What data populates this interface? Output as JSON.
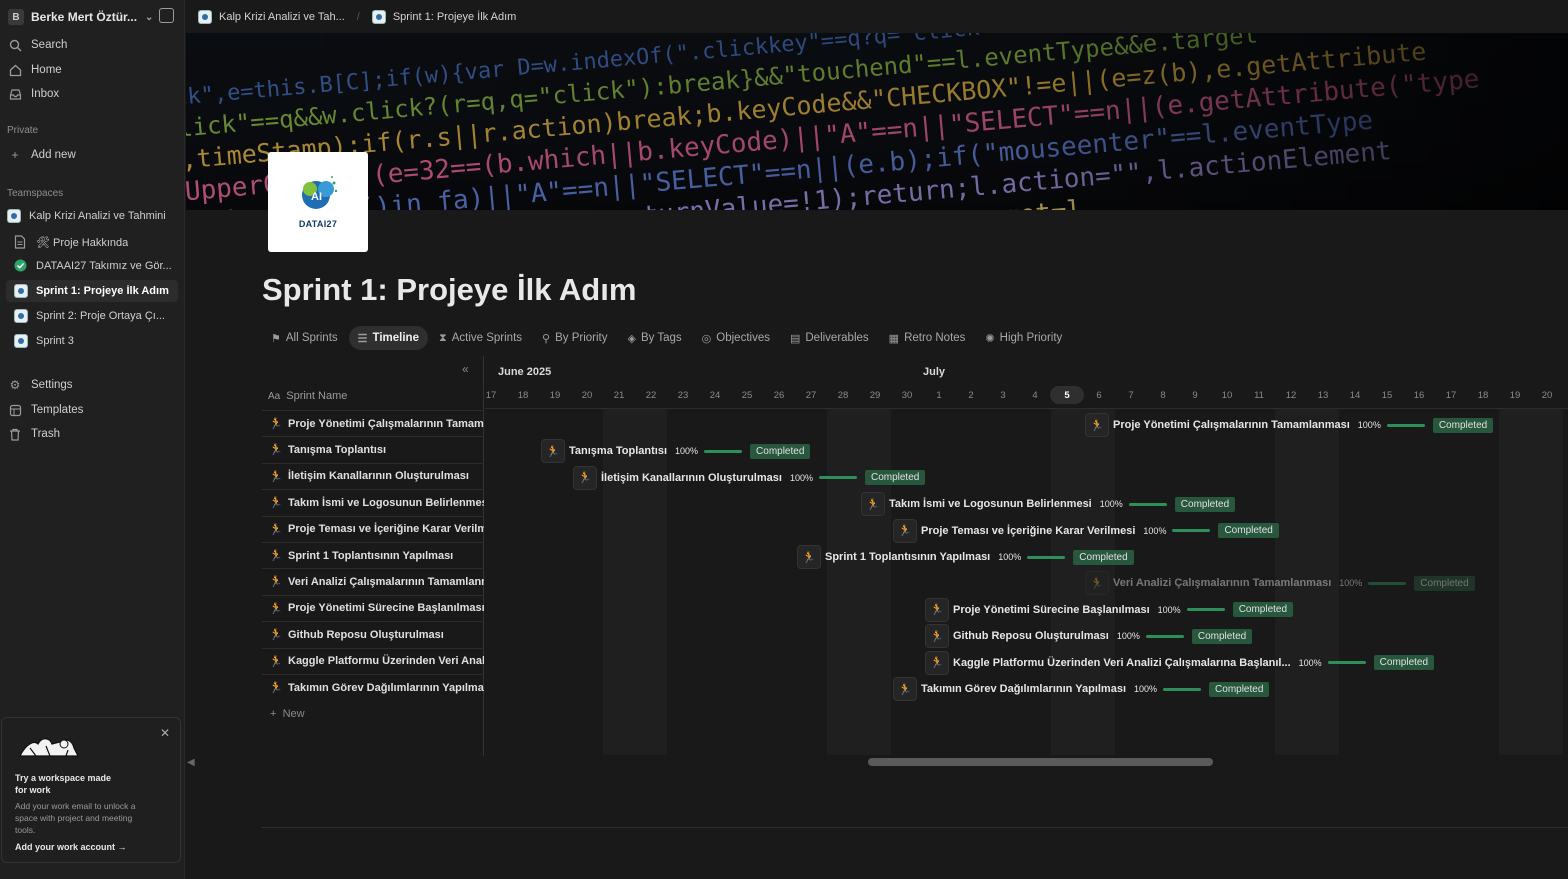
{
  "workspace": {
    "avatar": "B",
    "name": "Berke Mert Öztür..."
  },
  "sidebar": {
    "nav": [
      {
        "label": "Search",
        "icon": "search-icon"
      },
      {
        "label": "Home",
        "icon": "home-icon"
      },
      {
        "label": "Inbox",
        "icon": "inbox-icon"
      }
    ],
    "private_label": "Private",
    "add_new": "Add new",
    "teamspaces_label": "Teamspaces",
    "teamspace": "Kalp Krizi Analizi ve Tahmini",
    "pages": [
      {
        "label": "🛠 Proje Hakkında",
        "icon": "document-icon"
      },
      {
        "label": "DATAAI27 Takımız ve Gör...",
        "icon": "check-circle-icon"
      },
      {
        "label": "Sprint 1: Projeye İlk Adım",
        "icon": "page-logo-icon",
        "active": true
      },
      {
        "label": "Sprint 2: Proje Ortaya Çı...",
        "icon": "page-logo-icon"
      },
      {
        "label": "Sprint 3",
        "icon": "page-logo-icon"
      }
    ],
    "bottom": [
      {
        "label": "Settings",
        "icon": "gear-icon"
      },
      {
        "label": "Templates",
        "icon": "templates-icon"
      },
      {
        "label": "Trash",
        "icon": "trash-icon"
      }
    ],
    "promo": {
      "title": "Try a workspace made for work",
      "text": "Add your work email to unlock a space with project and meeting tools.",
      "cta": "Add your work account"
    }
  },
  "tabs": [
    {
      "label": "Kalp Krizi Analizi ve Tah..."
    },
    {
      "label": "Sprint 1: Projeye İlk Adım"
    }
  ],
  "logo_text": "DATAI27",
  "page_title": "Sprint 1: Projeye İlk Adım",
  "views": [
    {
      "label": "All Sprints",
      "icon": "flag-icon"
    },
    {
      "label": "Timeline",
      "icon": "timeline-icon",
      "active": true
    },
    {
      "label": "Active Sprints",
      "icon": "hourglass-icon"
    },
    {
      "label": "By Priority",
      "icon": "pin-icon"
    },
    {
      "label": "By Tags",
      "icon": "tag-icon"
    },
    {
      "label": "Objectives",
      "icon": "target-icon"
    },
    {
      "label": "Deliverables",
      "icon": "box-icon"
    },
    {
      "label": "Retro Notes",
      "icon": "notes-icon"
    },
    {
      "label": "High Priority",
      "icon": "fire-icon"
    }
  ],
  "table": {
    "column": "Sprint Name",
    "new_label": "New"
  },
  "timeline": {
    "months": [
      {
        "label": "June 2025"
      },
      {
        "label": "July"
      }
    ],
    "days": [
      "17",
      "18",
      "19",
      "20",
      "21",
      "22",
      "23",
      "24",
      "25",
      "26",
      "27",
      "28",
      "29",
      "30",
      "1",
      "2",
      "3",
      "4",
      "5",
      "6",
      "7",
      "8",
      "9",
      "10",
      "11",
      "12",
      "13",
      "14",
      "15",
      "16",
      "17",
      "18",
      "19",
      "20"
    ],
    "today": "5"
  },
  "rows": [
    {
      "name": "Proje Yönetimi Çalışmalarının Tamamlanması",
      "start_day": "5",
      "progress": "100%",
      "status": "Completed"
    },
    {
      "name": "Tanışma Toplantısı",
      "start_day": "18",
      "progress": "100%",
      "status": "Completed"
    },
    {
      "name": "İletişim Kanallarının Oluşturulması",
      "start_day": "19",
      "progress": "100%",
      "status": "Completed"
    },
    {
      "name": "Takım İsmi ve Logosunun Belirlenmesi",
      "start_day": "28",
      "progress": "100%",
      "status": "Completed"
    },
    {
      "name": "Proje Teması ve İçeriğine Karar Verilmesi",
      "start_day": "29",
      "progress": "100%",
      "status": "Completed"
    },
    {
      "name": "Sprint 1 Toplantısının Yapılması",
      "start_day": "26",
      "progress": "100%",
      "status": "Completed"
    },
    {
      "name": "Veri Analizi Çalışmalarının Tamamlanması",
      "start_day": "5",
      "progress": "100%",
      "status": "Completed",
      "dim": true
    },
    {
      "name": "Proje Yönetimi Sürecine Başlanılması",
      "start_day": "30",
      "progress": "100%",
      "status": "Completed"
    },
    {
      "name": "Github Reposu Oluşturulması",
      "start_day": "30",
      "progress": "100%",
      "status": "Completed"
    },
    {
      "name": "Kaggle Platformu Üzerinden Veri Analizi Çalışmalarına Başlanıl...",
      "table_name": "Kaggle Platformu Üzerinden Veri Analizi",
      "start_day": "30",
      "progress": "100%",
      "status": "Completed"
    },
    {
      "name": "Takımın Görev Dağılımlarının Yapılması",
      "start_day": "29",
      "progress": "100%",
      "status": "Completed"
    }
  ],
  "colors": {
    "status_bg": "#27573d",
    "progress": "#2f8f5b",
    "background": "#191919",
    "sidebar": "#202020"
  }
}
